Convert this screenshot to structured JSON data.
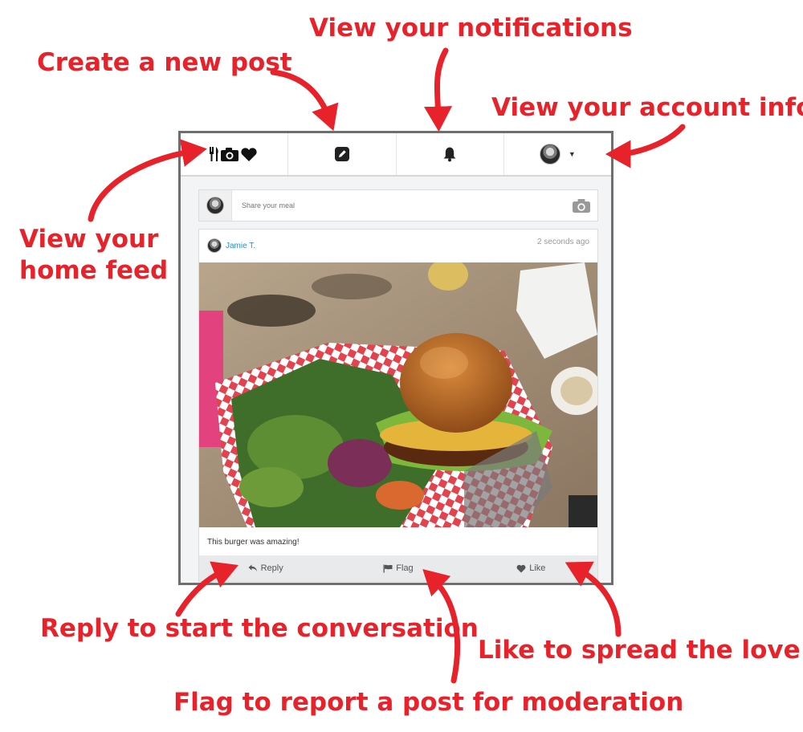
{
  "callouts": {
    "notifications": "View your notifications",
    "create_post": "Create a new post",
    "account": "View your account info",
    "home_line1": "View your",
    "home_line2": "home feed",
    "reply": "Reply to start the conversation",
    "like": "Like to spread the love",
    "flag": "Flag to report a post for moderation"
  },
  "nav": {
    "items": [
      {
        "icon": "logo-fork-knife-camera-heart-icon"
      },
      {
        "icon": "pencil-square-icon"
      },
      {
        "icon": "bell-icon"
      },
      {
        "icon": "user-avatar-dropdown"
      }
    ]
  },
  "composer": {
    "placeholder": "Share your meal",
    "icon": "camera-icon"
  },
  "post": {
    "author": "Jamie T.",
    "time": "2 seconds ago",
    "caption": "This burger was amazing!",
    "actions": [
      {
        "label": "Reply",
        "icon": "reply-arrow-icon"
      },
      {
        "label": "Flag",
        "icon": "flag-icon"
      },
      {
        "label": "Like",
        "icon": "heart-icon"
      }
    ]
  },
  "colors": {
    "callout": "#e8222a",
    "link": "#2a8fc9",
    "action_bar": "#e9eaec"
  }
}
